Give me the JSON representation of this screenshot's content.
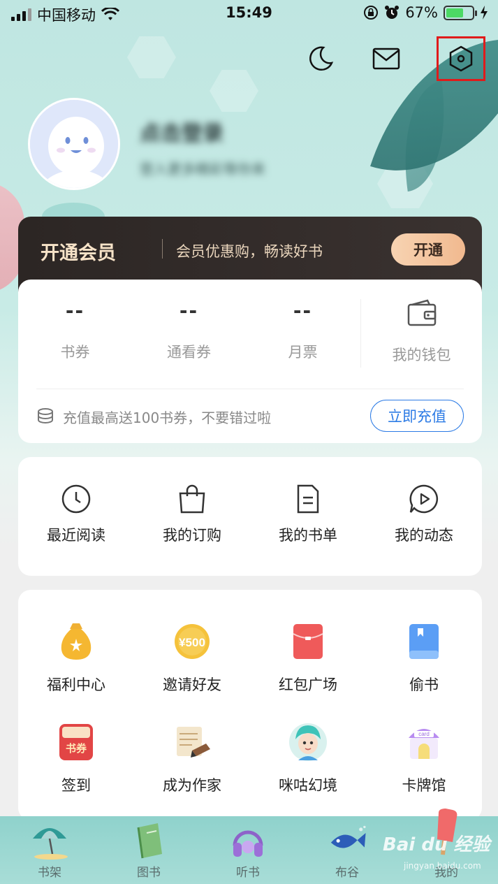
{
  "status_bar": {
    "carrier": "中国移动",
    "time": "15:49",
    "battery": "67%"
  },
  "profile": {
    "name": "点击登录",
    "subtitle": "登入更多精彩等你来"
  },
  "member": {
    "title": "开通会员",
    "desc": "会员优惠购，畅读好书",
    "button": "开通"
  },
  "wallet": {
    "stats": [
      {
        "value": "--",
        "label": "书券"
      },
      {
        "value": "--",
        "label": "通看券"
      },
      {
        "value": "--",
        "label": "月票"
      }
    ],
    "wallet_label": "我的钱包",
    "recharge_text": "充值最高送100书券，不要错过啦",
    "recharge_button": "立即充值"
  },
  "quick_menu": [
    {
      "label": "最近阅读",
      "icon": "clock-icon"
    },
    {
      "label": "我的订购",
      "icon": "bag-icon"
    },
    {
      "label": "我的书单",
      "icon": "document-icon"
    },
    {
      "label": "我的动态",
      "icon": "play-bubble-icon"
    }
  ],
  "features": [
    {
      "label": "福利中心",
      "icon": "money-bag-icon"
    },
    {
      "label": "邀请好友",
      "icon": "coin-500-icon",
      "badge": "¥500"
    },
    {
      "label": "红包广场",
      "icon": "red-envelope-icon"
    },
    {
      "label": "偷书",
      "icon": "blue-book-icon"
    },
    {
      "label": "签到",
      "icon": "checkin-calendar-icon",
      "badge": "书券"
    },
    {
      "label": "成为作家",
      "icon": "scroll-pen-icon"
    },
    {
      "label": "咪咕幻境",
      "icon": "avatar-character-icon"
    },
    {
      "label": "卡牌馆",
      "icon": "card-house-icon",
      "badge": "card"
    }
  ],
  "bottom_nav": [
    {
      "label": "书架",
      "icon": "beach-umbrella-icon"
    },
    {
      "label": "图书",
      "icon": "green-book-icon"
    },
    {
      "label": "听书",
      "icon": "headphones-icon"
    },
    {
      "label": "布谷",
      "icon": "fish-icon"
    },
    {
      "label": "我的",
      "icon": "popsicle-icon"
    }
  ],
  "watermark": {
    "text": "Bai du 经验",
    "sub": "jingyan.baidu.com"
  },
  "colors": {
    "accent_blue": "#2c7be5",
    "member_bg": "#2c2624",
    "member_gold": "#f1b98f",
    "highlight_red": "#e01b1b"
  }
}
